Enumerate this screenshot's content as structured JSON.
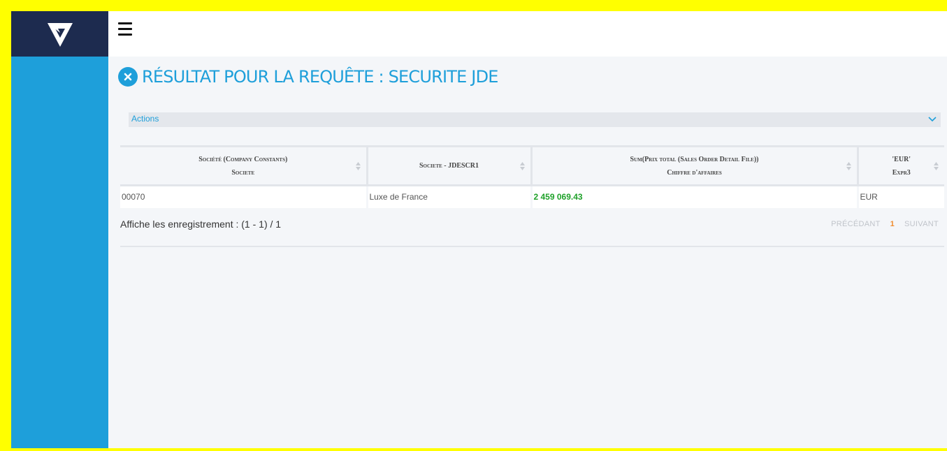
{
  "page": {
    "title": "RÉSULTAT POUR LA REQUÊTE : SECURITE JDE"
  },
  "actions": {
    "label": "Actions"
  },
  "table": {
    "columns": [
      {
        "line1": "Société (Company Constants)",
        "line2": "Societe"
      },
      {
        "line1": "Societe - JDESCR1",
        "line2": ""
      },
      {
        "line1": "Sum(Prix total (Sales Order Detail File))",
        "line2": "Chiffre d'affaires"
      },
      {
        "line1": "'EUR'",
        "line2": "Expr3"
      }
    ],
    "rows": [
      [
        "00070",
        "Luxe de France",
        "2 459 069.43",
        "EUR"
      ]
    ]
  },
  "footer": {
    "records_info": "Affiche les enregistrement : (1 - 1) / 1",
    "prev_label": "PRÉCÉDANT",
    "current_page": "1",
    "next_label": "SUIVANT"
  },
  "icons": {
    "logo": "v-logo-icon",
    "menu": "hamburger-menu-icon",
    "close": "close-circle-icon",
    "chevron": "chevron-down-icon",
    "sort": "sort-icon"
  },
  "colors": {
    "accent": "#1e9fda",
    "logo_bg": "#1d2b4f",
    "amount": "#1fa12a",
    "current_page": "#f08c2e",
    "border": "#ffff00"
  }
}
